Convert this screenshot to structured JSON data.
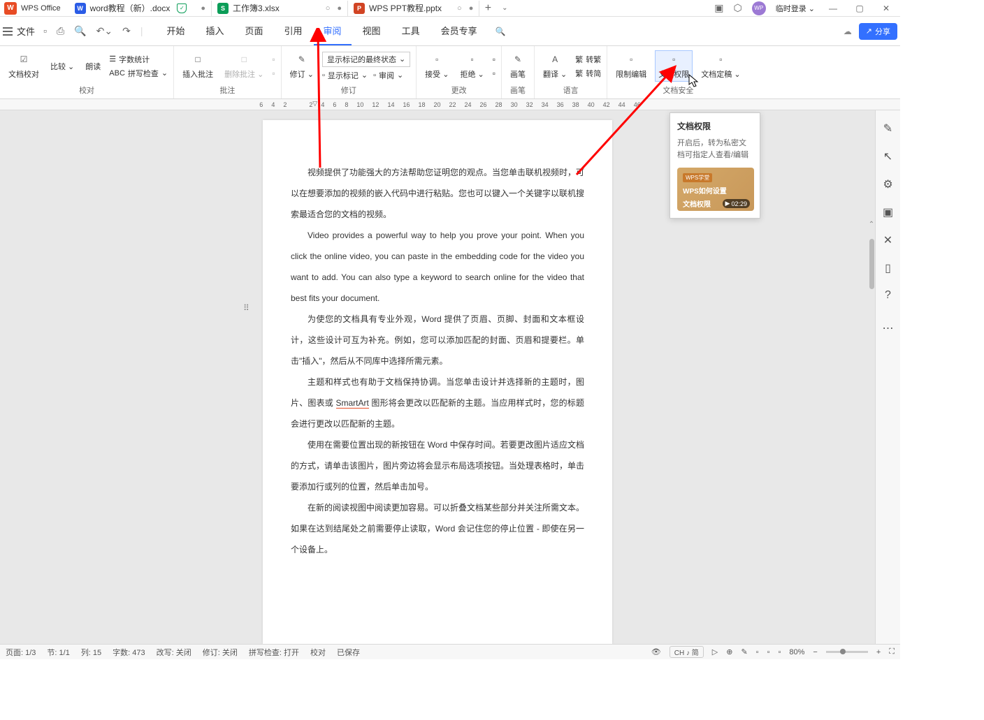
{
  "app_name": "WPS Office",
  "tabs": [
    {
      "label": "word教程（新）.docx",
      "type": "W"
    },
    {
      "label": "工作簿3.xlsx",
      "type": "S"
    },
    {
      "label": "WPS PPT教程.pptx",
      "type": "P"
    }
  ],
  "login_text": "临时登录",
  "file_menu": "文件",
  "main_tabs": [
    "开始",
    "插入",
    "页面",
    "引用",
    "审阅",
    "视图",
    "工具",
    "会员专享"
  ],
  "active_main_tab": "审阅",
  "share_label": "分享",
  "ribbon": {
    "proofing": {
      "compare": "文档校对",
      "compare2": "比较",
      "read": "朗读",
      "wordcount": "字数统计",
      "spellcheck": "拼写检查",
      "group": "校对"
    },
    "comments": {
      "insert": "插入批注",
      "delete": "删除批注",
      "group": "批注"
    },
    "revision": {
      "track": "修订",
      "display_mode": "显示标记的最终状态",
      "show_markup": "显示标记",
      "review_pane": "审阅",
      "group": "修订"
    },
    "changes": {
      "accept": "接受",
      "reject": "拒绝",
      "group": "更改"
    },
    "ink": {
      "pen": "画笔",
      "group": "画笔"
    },
    "language": {
      "translate": "翻译",
      "s2t": "转繁",
      "t2s": "转简",
      "group": "语言"
    },
    "protect": {
      "restrict": "限制编辑",
      "permission": "文档权限",
      "finalize": "文档定稿",
      "group": "文档安全"
    }
  },
  "ruler_nums": [
    "6",
    "4",
    "2",
    "2",
    "4",
    "6",
    "8",
    "10",
    "12",
    "14",
    "16",
    "18",
    "20",
    "22",
    "24",
    "26",
    "28",
    "30",
    "32",
    "34",
    "36",
    "38",
    "40",
    "42",
    "44",
    "46"
  ],
  "tooltip": {
    "title": "文档权限",
    "desc": "开启后，转为私密文档可指定人查看/编辑",
    "thumb_badge": "WPS学堂",
    "thumb_text1": "WPS如何设置",
    "thumb_text2": "文档权限",
    "duration": "02:29"
  },
  "document": {
    "p1": "视频提供了功能强大的方法帮助您证明您的观点。当您单击联机视频时，可以在想要添加的视频的嵌入代码中进行粘贴。您也可以键入一个关键字以联机搜索最适合您的文档的视频。",
    "p2": "Video provides a powerful way to help you prove your point. When you click the online video, you can paste in the embedding code for the video you want to add. You can also type a keyword to search online for the video that best fits your document.",
    "p3": "为使您的文档具有专业外观，Word 提供了页眉、页脚、封面和文本框设计，这些设计可互为补充。例如，您可以添加匹配的封面、页眉和提要栏。单击\"插入\"，然后从不同库中选择所需元素。",
    "p4_a": "主题和样式也有助于文档保持协调。当您单击设计并选择新的主题时，图片、图表或 ",
    "p4_smart": "SmartArt",
    "p4_b": " 图形将会更改以匹配新的主题。当应用样式时，您的标题会进行更改以匹配新的主题。",
    "p5": "使用在需要位置出现的新按钮在 Word 中保存时间。若要更改图片适应文档的方式，请单击该图片，图片旁边将会显示布局选项按钮。当处理表格时，单击要添加行或列的位置，然后单击加号。",
    "p6": "在新的阅读视图中阅读更加容易。可以折叠文档某些部分并关注所需文本。如果在达到结尾处之前需要停止读取，Word 会记住您的停止位置 - 即使在另一个设备上。"
  },
  "status": {
    "page": "页面: 1/3",
    "section": "节: 1/1",
    "col": "列: 15",
    "words": "字数: 473",
    "track_changes": "改写: 关闭",
    "revision": "修订: 关闭",
    "spell": "拼写检查: 打开",
    "proof": "校对",
    "saved": "已保存",
    "ime": "CH ♪ 简",
    "zoom": "80%"
  },
  "icon_glyphs": {
    "s": "简",
    "f": "繁"
  }
}
